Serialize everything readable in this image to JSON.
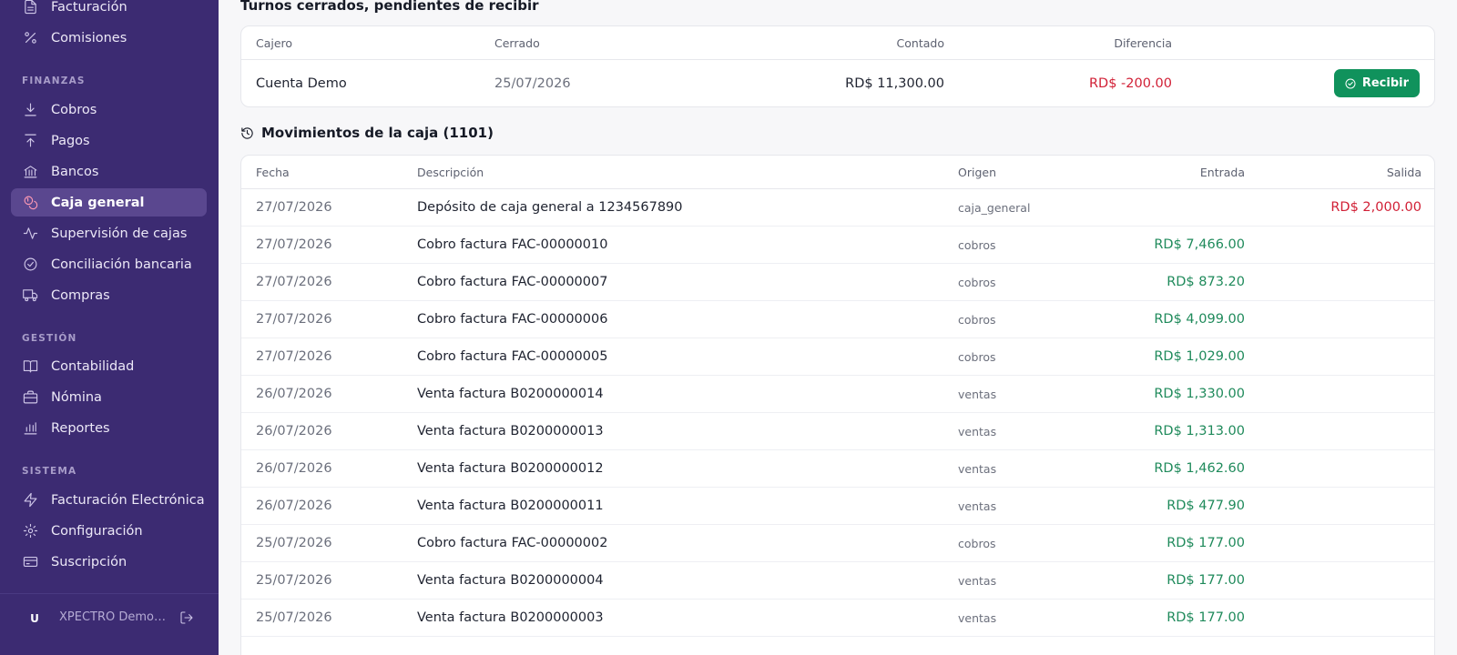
{
  "sidebar": {
    "items_top": [
      {
        "label": "Facturación",
        "icon": "file-text-icon"
      },
      {
        "label": "Comisiones",
        "icon": "percent-icon"
      }
    ],
    "sections": [
      {
        "label": "FINANZAS"
      },
      {
        "label": "GESTIÓN"
      },
      {
        "label": "SISTEMA"
      }
    ],
    "finanzas": [
      {
        "label": "Cobros",
        "icon": "download-icon"
      },
      {
        "label": "Pagos",
        "icon": "upload-icon"
      },
      {
        "label": "Bancos",
        "icon": "bank-icon"
      },
      {
        "label": "Caja general",
        "icon": "coins-icon",
        "active": true
      },
      {
        "label": "Supervisión de cajas",
        "icon": "activity-icon"
      },
      {
        "label": "Conciliación bancaria",
        "icon": "check-circle-icon"
      },
      {
        "label": "Compras",
        "icon": "truck-icon"
      }
    ],
    "gestion": [
      {
        "label": "Contabilidad",
        "icon": "book-icon"
      },
      {
        "label": "Nómina",
        "icon": "briefcase-icon"
      },
      {
        "label": "Reportes",
        "icon": "bar-chart-icon"
      }
    ],
    "sistema": [
      {
        "label": "Facturación Electrónica",
        "icon": "zap-icon"
      },
      {
        "label": "Configuración",
        "icon": "gear-icon"
      },
      {
        "label": "Suscripción",
        "icon": "credit-card-icon"
      }
    ],
    "footer": {
      "avatar": "U",
      "org": "XPECTRO Demo S.R.L."
    }
  },
  "pending": {
    "title": "Turnos cerrados, pendientes de recibir",
    "headers": {
      "cajero": "Cajero",
      "cerrado": "Cerrado",
      "contado": "Contado",
      "diferencia": "Diferencia"
    },
    "rows": [
      {
        "cajero": "Cuenta Demo",
        "cerrado": "25/07/2026",
        "contado": "RD$ 11,300.00",
        "diferencia": "RD$ -200.00",
        "action": "Recibir"
      }
    ]
  },
  "movements": {
    "title": "Movimientos de la caja (1101)",
    "headers": {
      "fecha": "Fecha",
      "descripcion": "Descripción",
      "origen": "Origen",
      "entrada": "Entrada",
      "salida": "Salida"
    },
    "rows": [
      {
        "fecha": "27/07/2026",
        "descripcion": "Depósito de caja general a 1234567890",
        "origen": "caja_general",
        "entrada": "",
        "salida": "RD$ 2,000.00"
      },
      {
        "fecha": "27/07/2026",
        "descripcion": "Cobro factura FAC-00000010",
        "origen": "cobros",
        "entrada": "RD$ 7,466.00",
        "salida": ""
      },
      {
        "fecha": "27/07/2026",
        "descripcion": "Cobro factura FAC-00000007",
        "origen": "cobros",
        "entrada": "RD$ 873.20",
        "salida": ""
      },
      {
        "fecha": "27/07/2026",
        "descripcion": "Cobro factura FAC-00000006",
        "origen": "cobros",
        "entrada": "RD$ 4,099.00",
        "salida": ""
      },
      {
        "fecha": "27/07/2026",
        "descripcion": "Cobro factura FAC-00000005",
        "origen": "cobros",
        "entrada": "RD$ 1,029.00",
        "salida": ""
      },
      {
        "fecha": "26/07/2026",
        "descripcion": "Venta factura B0200000014",
        "origen": "ventas",
        "entrada": "RD$ 1,330.00",
        "salida": ""
      },
      {
        "fecha": "26/07/2026",
        "descripcion": "Venta factura B0200000013",
        "origen": "ventas",
        "entrada": "RD$ 1,313.00",
        "salida": ""
      },
      {
        "fecha": "26/07/2026",
        "descripcion": "Venta factura B0200000012",
        "origen": "ventas",
        "entrada": "RD$ 1,462.60",
        "salida": ""
      },
      {
        "fecha": "26/07/2026",
        "descripcion": "Venta factura B0200000011",
        "origen": "ventas",
        "entrada": "RD$ 477.90",
        "salida": ""
      },
      {
        "fecha": "25/07/2026",
        "descripcion": "Cobro factura FAC-00000002",
        "origen": "cobros",
        "entrada": "RD$ 177.00",
        "salida": ""
      },
      {
        "fecha": "25/07/2026",
        "descripcion": "Venta factura B0200000004",
        "origen": "ventas",
        "entrada": "RD$ 177.00",
        "salida": ""
      },
      {
        "fecha": "25/07/2026",
        "descripcion": "Venta factura B0200000003",
        "origen": "ventas",
        "entrada": "RD$ 177.00",
        "salida": ""
      }
    ]
  },
  "colors": {
    "sidebar": "#3c2b72",
    "active": "#5a478f",
    "positive": "#1f8a5b",
    "negative": "#d11f35",
    "button": "#10925c"
  }
}
